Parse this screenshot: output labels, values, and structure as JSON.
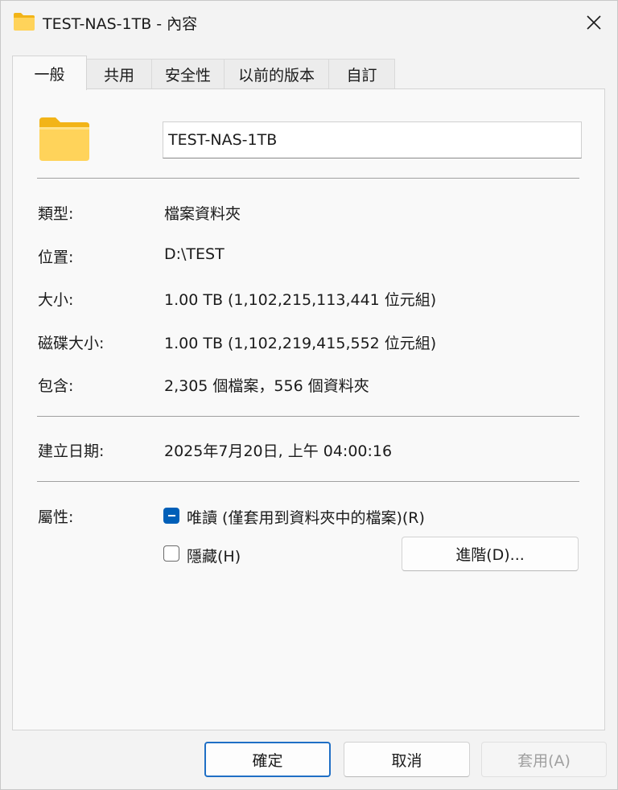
{
  "window": {
    "title": "TEST-NAS-1TB - 內容",
    "close_icon": "close-icon"
  },
  "tabs": [
    {
      "label": "一般",
      "active": true
    },
    {
      "label": "共用",
      "active": false
    },
    {
      "label": "安全性",
      "active": false
    },
    {
      "label": "以前的版本",
      "active": false
    },
    {
      "label": "自訂",
      "active": false
    }
  ],
  "general": {
    "folder_name": "TEST-NAS-1TB",
    "folder_icon": "folder-icon",
    "type_label": "類型:",
    "type_value": "檔案資料夾",
    "location_label": "位置:",
    "location_value": "D:\\TEST",
    "size_label": "大小:",
    "size_value": "1.00 TB (1,102,215,113,441 位元組)",
    "disk_size_label": "磁碟大小:",
    "disk_size_value": "1.00 TB (1,102,219,415,552 位元組)",
    "contains_label": "包含:",
    "contains_value": "2,305 個檔案，556 個資料夾",
    "created_label": "建立日期:",
    "created_value": "2025年7月20日, 上午 04:00:16",
    "attributes_label": "屬性:",
    "readonly_label": "唯讀 (僅套用到資料夾中的檔案)(R)",
    "readonly_state": "mixed",
    "hidden_label": "隱藏(H)",
    "hidden_state": "unchecked",
    "advanced_button": "進階(D)..."
  },
  "footer": {
    "ok_button": "確定",
    "cancel_button": "取消",
    "apply_button": "套用(A)"
  },
  "colors": {
    "accent": "#005fb8",
    "folder_front": "#ffd35a",
    "folder_back": "#f2b418"
  }
}
